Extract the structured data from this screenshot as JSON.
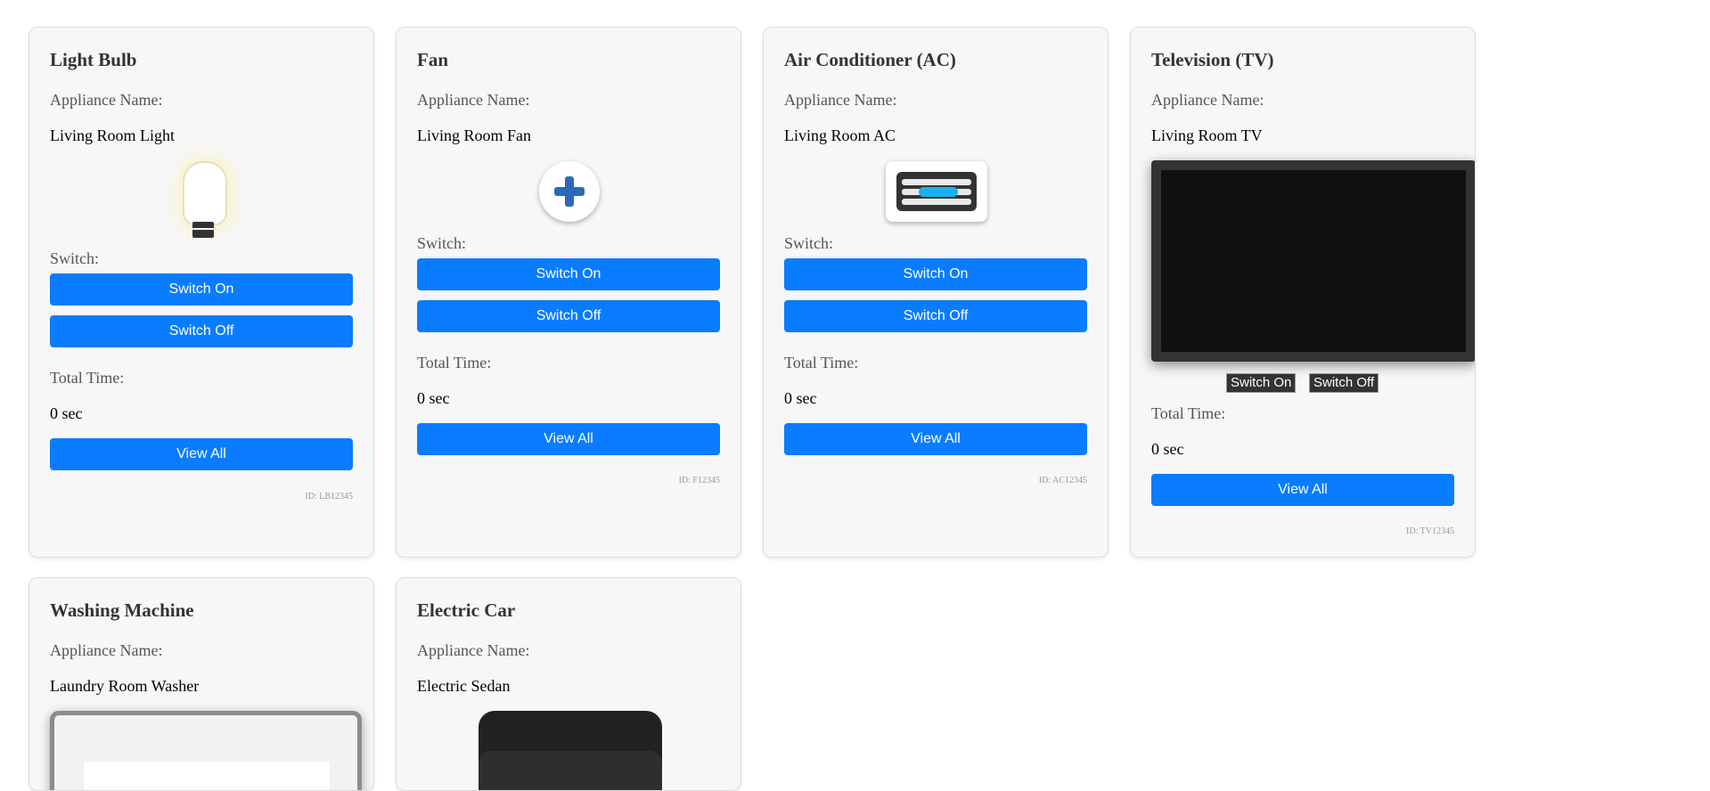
{
  "cards": [
    {
      "title": "Light Bulb",
      "name_label": "Appliance Name:",
      "name": "Living Room Light",
      "switch_label": "Switch:",
      "on_label": "Switch On",
      "off_label": "Switch Off",
      "time_label": "Total Time:",
      "time": "0 sec",
      "view_label": "View All",
      "id": "ID: LB12345",
      "icon": "light-bulb-icon"
    },
    {
      "title": "Fan",
      "name_label": "Appliance Name:",
      "name": "Living Room Fan",
      "switch_label": "Switch:",
      "on_label": "Switch On",
      "off_label": "Switch Off",
      "time_label": "Total Time:",
      "time": "0 sec",
      "view_label": "View All",
      "id": "ID: F12345",
      "icon": "fan-icon"
    },
    {
      "title": "Air Conditioner (AC)",
      "name_label": "Appliance Name:",
      "name": "Living Room AC",
      "switch_label": "Switch:",
      "on_label": "Switch On",
      "off_label": "Switch Off",
      "time_label": "Total Time:",
      "time": "0 sec",
      "view_label": "View All",
      "id": "ID: AC12345",
      "icon": "air-conditioner-icon"
    },
    {
      "title": "Television (TV)",
      "name_label": "Appliance Name:",
      "name": "Living Room TV",
      "on_label": "Switch On",
      "off_label": "Switch Off",
      "time_label": "Total Time:",
      "time": "0 sec",
      "view_label": "View All",
      "id": "ID: TV12345",
      "icon": "television-icon"
    },
    {
      "title": "Washing Machine",
      "name_label": "Appliance Name:",
      "name": "Laundry Room Washer",
      "icon": "washing-machine-icon"
    },
    {
      "title": "Electric Car",
      "name_label": "Appliance Name:",
      "name": "Electric Sedan",
      "icon": "electric-car-icon"
    }
  ],
  "colors": {
    "button": "#0a7cff",
    "card_bg": "#f7f7f7",
    "ac_light": "#1ab0f0"
  }
}
